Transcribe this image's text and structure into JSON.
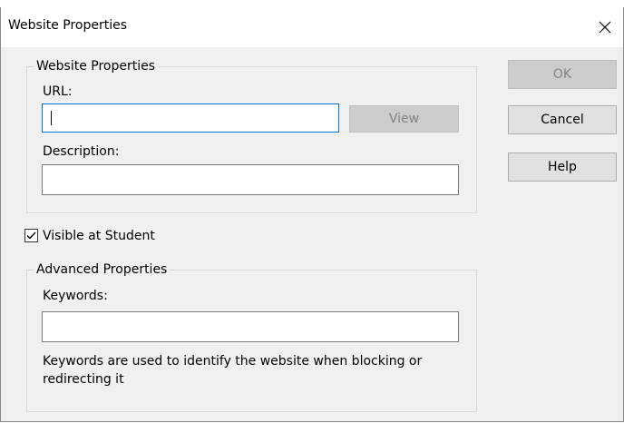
{
  "window": {
    "title": "Website Properties",
    "close_glyph": "✕"
  },
  "website_group": {
    "title": "Website Properties",
    "url_label": "URL:",
    "url_value": "",
    "view_label": "View",
    "description_label": "Description:",
    "description_value": ""
  },
  "visible_checkbox": {
    "label": "Visible at Student",
    "checked": true
  },
  "advanced_group": {
    "title": "Advanced Properties",
    "keywords_label": "Keywords:",
    "keywords_value": "",
    "hint": "Keywords are used to identify the website when blocking or redirecting it"
  },
  "buttons": {
    "ok_label": "OK",
    "cancel_label": "Cancel",
    "help_label": "Help"
  },
  "icons": {
    "close": "close-icon",
    "checkmark": "checkmark-icon"
  },
  "colors": {
    "dialog_bg": "#f0f0f0",
    "focus_border": "#0078d7",
    "disabled_button": "#cccccc",
    "disabled_text": "#838383",
    "button_bg": "#e1e1e1"
  }
}
